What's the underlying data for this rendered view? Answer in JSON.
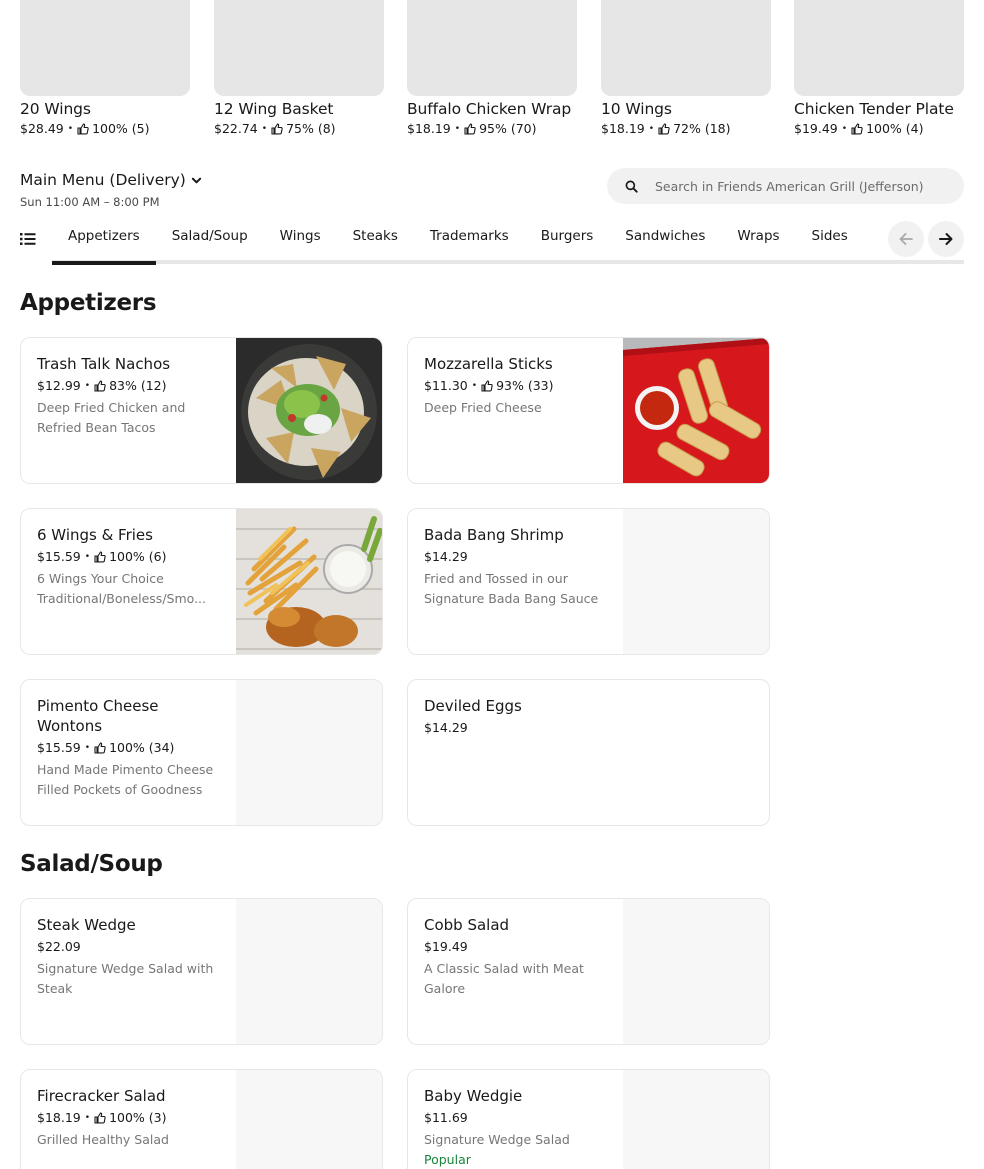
{
  "carousel": [
    {
      "title": "20 Wings",
      "price": "$28.49",
      "rating": "100% (5)"
    },
    {
      "title": "12 Wing Basket",
      "price": "$22.74",
      "rating": "75% (8)"
    },
    {
      "title": "Buffalo Chicken Wrap",
      "price": "$18.19",
      "rating": "95% (70)"
    },
    {
      "title": "10 Wings",
      "price": "$18.19",
      "rating": "72% (18)"
    },
    {
      "title": "Chicken Tender Plate",
      "price": "$19.49",
      "rating": "100% (4)"
    }
  ],
  "menu": {
    "title": "Main Menu (Delivery)",
    "hours": "Sun 11:00 AM – 8:00 PM",
    "search_placeholder": "Search in Friends American Grill (Jefferson)"
  },
  "tabs": [
    "Appetizers",
    "Salad/Soup",
    "Wings",
    "Steaks",
    "Trademarks",
    "Burgers",
    "Sandwiches",
    "Wraps",
    "Sides"
  ],
  "dot": "•",
  "sections": {
    "appetizers": {
      "title": "Appetizers",
      "items": [
        {
          "name": "Trash Talk Nachos",
          "price": "$12.99",
          "rating": "83% (12)",
          "desc": "Deep Fried Chicken and Refried Bean Tacos"
        },
        {
          "name": "Mozzarella Sticks",
          "price": "$11.30",
          "rating": "93% (33)",
          "desc": "Deep Fried Cheese"
        },
        {
          "name": "6 Wings & Fries",
          "price": "$15.59",
          "rating": "100% (6)",
          "desc": "6 Wings Your Choice Traditional/Boneless/Smo..."
        },
        {
          "name": "Bada Bang Shrimp",
          "price": "$14.29",
          "desc": "Fried and Tossed in our Signature Bada Bang Sauce"
        },
        {
          "name": "Pimento Cheese Wontons",
          "price": "$15.59",
          "rating": "100% (34)",
          "desc": "Hand Made Pimento Cheese Filled Pockets of Goodness"
        },
        {
          "name": "Deviled Eggs",
          "price": "$14.29"
        }
      ]
    },
    "salad": {
      "title": "Salad/Soup",
      "items": [
        {
          "name": "Steak Wedge",
          "price": "$22.09",
          "desc": "Signature Wedge Salad with Steak"
        },
        {
          "name": "Cobb Salad",
          "price": "$19.49",
          "desc": "A Classic Salad with Meat Galore"
        },
        {
          "name": "Firecracker Salad",
          "price": "$18.19",
          "rating": "100% (3)",
          "desc": "Grilled Healthy Salad"
        },
        {
          "name": "Baby Wedgie",
          "price": "$11.69",
          "desc": "Signature Wedge Salad",
          "badge": "Popular"
        }
      ]
    }
  },
  "colors": {
    "popular": "#17853b",
    "placeholder": "#e6e6e6"
  }
}
